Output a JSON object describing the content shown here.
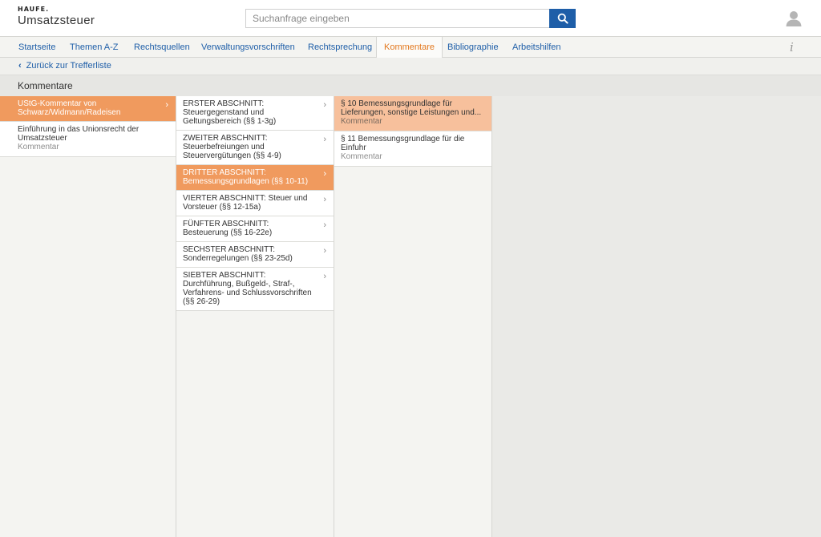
{
  "header": {
    "logo": "HAUFE.",
    "app_title": "Umsatzsteuer",
    "search_placeholder": "Suchanfrage eingeben",
    "search_icon": "search-icon",
    "user_icon": "user-icon"
  },
  "nav": {
    "tabs": [
      {
        "label": "Startseite"
      },
      {
        "label": "Themen A-Z"
      },
      {
        "label": "Rechtsquellen"
      },
      {
        "label": "Verwaltungsvorschriften"
      },
      {
        "label": "Rechtsprechung"
      },
      {
        "label": "Kommentare"
      },
      {
        "label": "Bibliographie"
      },
      {
        "label": "Arbeitshilfen"
      }
    ],
    "active_tab": "Kommentare",
    "info_label": "i"
  },
  "back": {
    "label": "Zurück zur Trefferliste"
  },
  "section": {
    "title": "Kommentare"
  },
  "column1": [
    {
      "title": "UStG-Kommentar von Schwarz/Widmann/Radeisen",
      "meta": "",
      "selected": true
    },
    {
      "title": "Einführung in das Unionsrecht der Umsatzsteuer",
      "meta": "Kommentar",
      "selected": false
    }
  ],
  "column2": [
    {
      "title": "ERSTER ABSCHNITT: Steuergegenstand und Geltungsbereich (§§ 1-3g)"
    },
    {
      "title": "ZWEITER ABSCHNITT: Steuerbefreiungen und Steuervergütungen (§§ 4-9)"
    },
    {
      "title": "DRITTER ABSCHNITT: Bemessungsgrundlagen (§§ 10-11)"
    },
    {
      "title": "VIERTER ABSCHNITT: Steuer und Vorsteuer (§§ 12-15a)"
    },
    {
      "title": "FÜNFTER ABSCHNITT: Besteuerung (§§ 16-22e)"
    },
    {
      "title": "SECHSTER ABSCHNITT: Sonderregelungen (§§ 23-25d)"
    },
    {
      "title": "SIEBTER ABSCHNITT: Durchführung, Bußgeld-, Straf-, Verfahrens- und Schlussvorschriften (§§ 26-29)"
    }
  ],
  "column3": [
    {
      "title": "§ 10 Bemessungsgrundlage für Lieferungen, sonstige Leistungen und...",
      "meta": "Kommentar"
    },
    {
      "title": "§ 11 Bemessungsgrundlage für die Einfuhr",
      "meta": "Kommentar"
    }
  ],
  "colors": {
    "accent_orange": "#f09a5e",
    "accent_orange_light": "#f7c09c",
    "link_blue": "#1e5ea8",
    "active_tab": "#e3781e"
  }
}
